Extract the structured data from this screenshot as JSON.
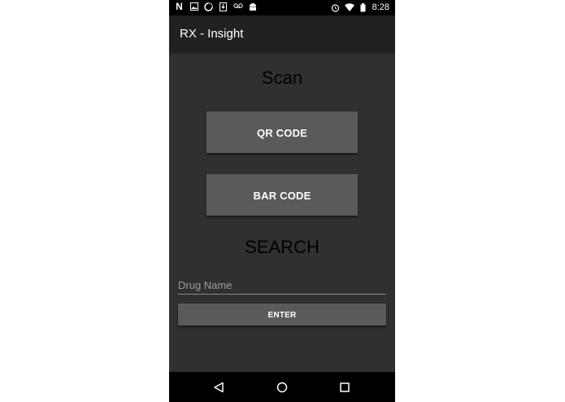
{
  "status_bar": {
    "time": "8:28",
    "left_icons": [
      "netflix-icon",
      "image-icon",
      "sync-icon",
      "download-icon",
      "voicemail-icon",
      "android-icon"
    ],
    "right_icons": [
      "alarm-icon",
      "wifi-icon",
      "battery-icon"
    ]
  },
  "toolbar": {
    "title": "RX - Insight"
  },
  "scan": {
    "heading": "Scan",
    "qr_button": "QR CODE",
    "barcode_button": "BAR CODE"
  },
  "search": {
    "heading": "SEARCH",
    "input_placeholder": "Drug Name",
    "enter_button": "ENTER"
  },
  "nav": {
    "icons": [
      "back-icon",
      "home-icon",
      "recents-icon"
    ]
  },
  "colors": {
    "background": "#303030",
    "toolbar": "#212121",
    "button": "#5a5a5a",
    "heading_text": "#000000"
  }
}
